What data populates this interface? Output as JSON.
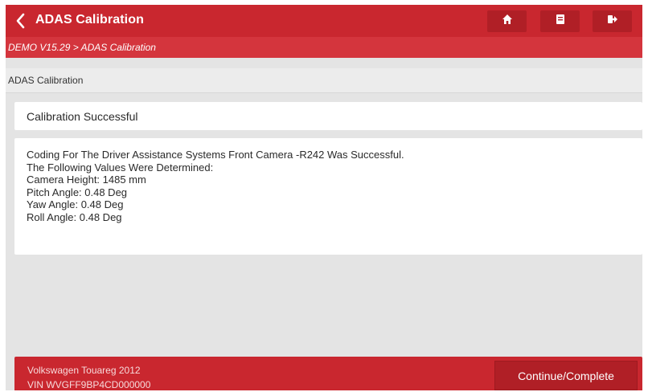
{
  "header": {
    "title": "ADAS Calibration",
    "back_icon": "chevron-left-icon",
    "buttons": [
      {
        "icon": "home-icon"
      },
      {
        "icon": "report-icon"
      },
      {
        "icon": "exit-icon"
      }
    ]
  },
  "breadcrumb": "DEMO V15.29 > ADAS Calibration",
  "section_title": "ADAS Calibration",
  "status": "Calibration Successful",
  "detail_lines": [
    "Coding For The Driver Assistance Systems Front Camera -R242 Was Successful.",
    "The Following Values Were Determined:",
    "Camera Height: 1485 mm",
    "Pitch Angle: 0.48 Deg",
    "Yaw Angle: 0.48 Deg",
    "Roll Angle: 0.48 Deg"
  ],
  "footer": {
    "vehicle": "Volkswagen Touareg 2012",
    "vin": "VIN WVGFF9BP4CD000000",
    "continue_label": "Continue/Complete"
  },
  "colors": {
    "primary_red": "#c9272f",
    "dark_red": "#b01f26",
    "background_gray": "#e4e4e4"
  }
}
